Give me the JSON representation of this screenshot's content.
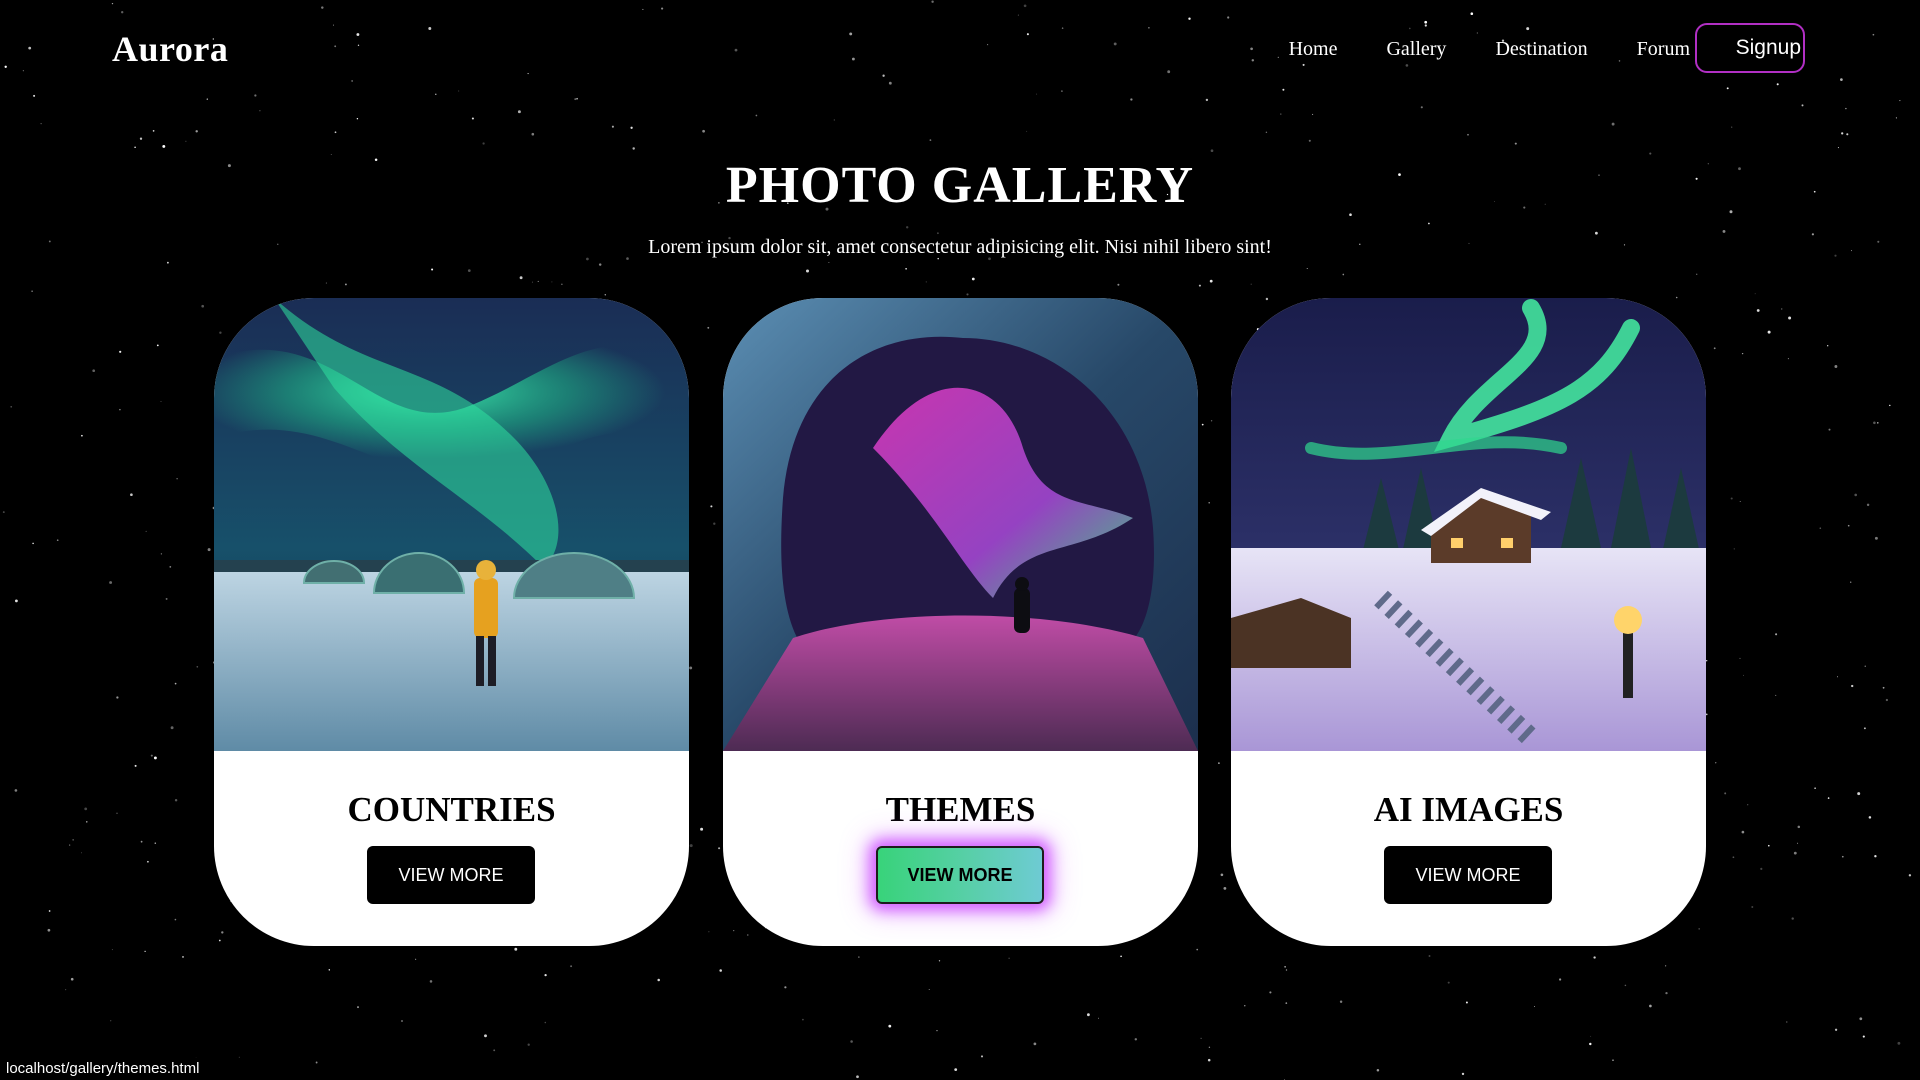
{
  "header": {
    "brand": "Aurora",
    "nav": [
      "Home",
      "Gallery",
      "Destination",
      "Forum"
    ],
    "signup_label": "Signup"
  },
  "hero": {
    "title": "PHOTO GALLERY",
    "subtitle": "Lorem ipsum dolor sit, amet consectetur adipisicing elit. Nisi nihil libero sint!"
  },
  "cards": [
    {
      "title": "COUNTRIES",
      "button": "VIEW MORE",
      "image": "aurora-over-glass-igloos-photo"
    },
    {
      "title": "THEMES",
      "button": "VIEW MORE",
      "image": "ice-cave-with-pink-aurora-photo"
    },
    {
      "title": "AI IMAGES",
      "button": "VIEW MORE",
      "image": "snowy-cabin-with-aurora-illustration"
    }
  ],
  "hover_state": {
    "card_index": 1,
    "glow_color": "#cc4cff",
    "button_gradient": [
      "#38d37a",
      "#6ecbd3"
    ]
  },
  "colors": {
    "background": "#000000",
    "signup_border": "#b12fc4",
    "card": "#ffffff",
    "button": "#000000"
  },
  "status_bar": {
    "url": "localhost/gallery/themes.html"
  }
}
